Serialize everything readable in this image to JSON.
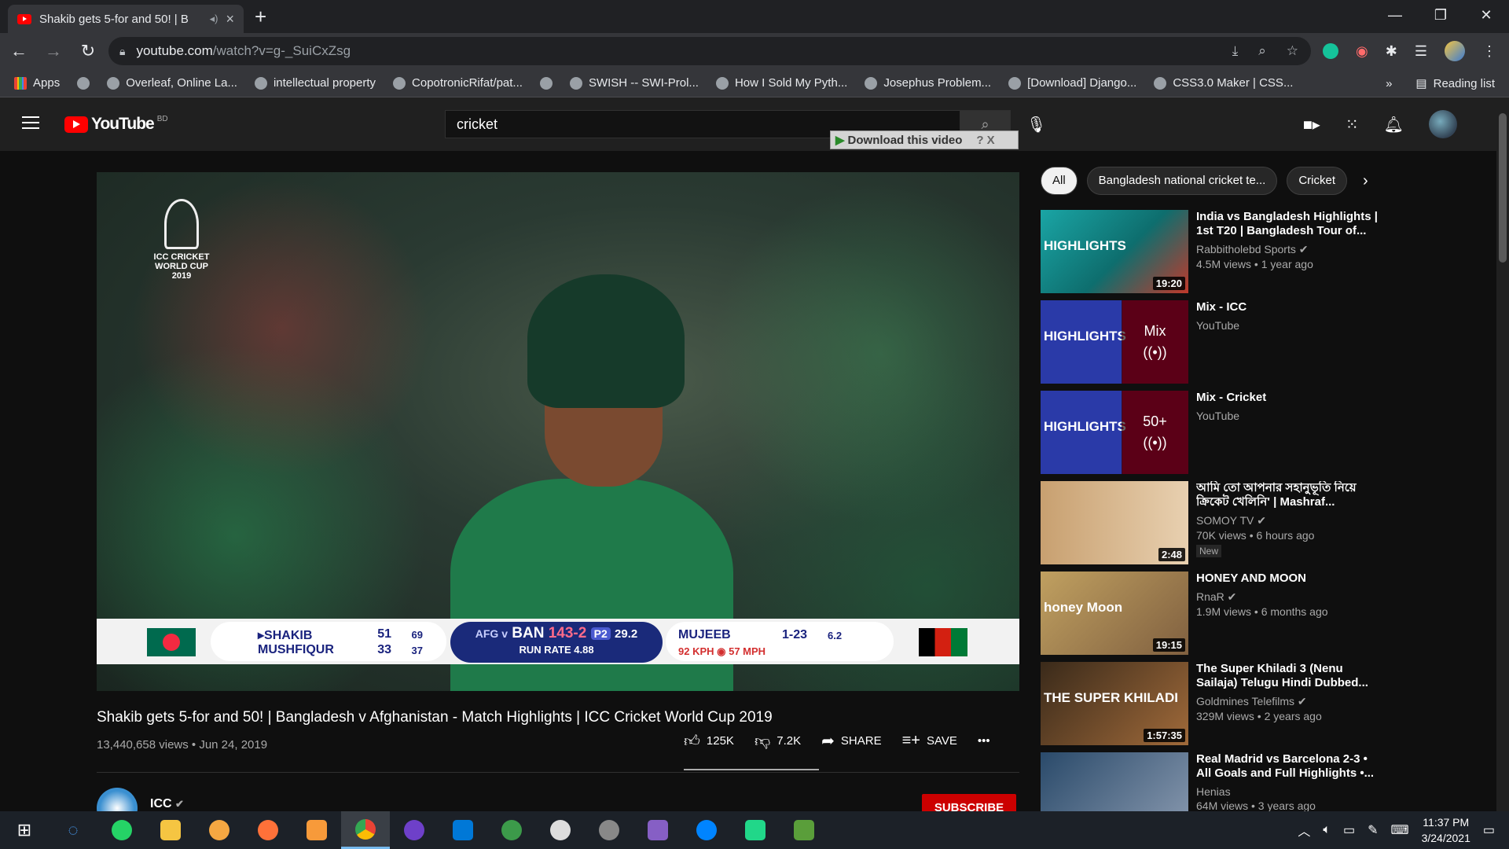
{
  "browser": {
    "tab_title": "Shakib gets 5-for and 50! | B",
    "url_host": "youtube.com",
    "url_path": "/watch?v=g-_SuiCxZsg",
    "window_controls": [
      "—",
      "❐",
      "✕"
    ]
  },
  "bookmarks": [
    {
      "label": "Apps",
      "icon": "apps-grid-icon"
    },
    {
      "label": "",
      "icon": "globe-icon"
    },
    {
      "label": "Overleaf, Online La...",
      "icon": "overleaf-icon"
    },
    {
      "label": "intellectual property",
      "icon": "bookmark-s-icon"
    },
    {
      "label": "CopotronicRifat/pat...",
      "icon": "github-icon"
    },
    {
      "label": "",
      "icon": "globe-icon"
    },
    {
      "label": "SWISH -- SWI-Prol...",
      "icon": "swish-icon"
    },
    {
      "label": "How I Sold My Pyth...",
      "icon": "youtube-icon"
    },
    {
      "label": "Josephus Problem...",
      "icon": "loading-icon"
    },
    {
      "label": "[Download] Django...",
      "icon": "django-icon"
    },
    {
      "label": "CSS3.0 Maker | CSS...",
      "icon": "globe-icon"
    }
  ],
  "bookmarks_more": "»",
  "reading_list": "Reading list",
  "youtube": {
    "logo_text": "YouTube",
    "country": "BD",
    "search_value": "cricket",
    "download_bar": "Download this video",
    "download_help": "?",
    "download_close": "X"
  },
  "video": {
    "title": "Shakib gets 5-for and 50! | Bangladesh v Afghanistan - Match Highlights | ICC Cricket World Cup 2019",
    "meta": "13,440,658 views • Jun 24, 2019",
    "likes": "125K",
    "dislikes": "7.2K",
    "share": "SHARE",
    "save": "SAVE",
    "more": "•••",
    "overlay_logo": "ICC CRICKET WORLD CUP 2019",
    "channel": "ICC",
    "subscribe": "SUBSCRIBE"
  },
  "scoreboard": {
    "batsmen": [
      {
        "name": "▸SHAKIB",
        "runs": "51",
        "balls": "69"
      },
      {
        "name": "MUSHFIQUR",
        "runs": "33",
        "balls": "37"
      }
    ],
    "afg_v": "AFG v",
    "team": "BAN",
    "score": "143-2",
    "powerplay": "P2",
    "overs": "29.2",
    "run_rate": "RUN RATE 4.88",
    "bowler": "MUJEEB",
    "bowler_figures": "1-23",
    "bowler_overs": "6.2",
    "speed": "92 KPH  ◉  57 MPH"
  },
  "chips": [
    "All",
    "Bangladesh national cricket te...",
    "Cricket"
  ],
  "recommendations": [
    {
      "title": "India vs Bangladesh Highlights | 1st T20 | Bangladesh Tour of...",
      "channel": "Rabbitholebd Sports ✔",
      "views": "4.5M views • 1 year ago",
      "duration": "19:20",
      "thumb_text": "HIGHLIGHTS",
      "badge": "",
      "mix": ""
    },
    {
      "title": "Mix - ICC",
      "channel": "YouTube",
      "views": "",
      "duration": "",
      "thumb_text": "HIGHLIGHTS",
      "badge": "",
      "mix": "Mix"
    },
    {
      "title": "Mix - Cricket",
      "channel": "YouTube",
      "views": "",
      "duration": "",
      "thumb_text": "HIGHLIGHTS",
      "badge": "",
      "mix": "50+"
    },
    {
      "title": "আমি তো আপনার সহানুভূতি নিয়ে ক্রিকেট খেলিনি' | Mashraf...",
      "channel": "SOMOY TV ✔",
      "views": "70K views • 6 hours ago",
      "duration": "2:48",
      "thumb_text": "",
      "badge": "New",
      "mix": ""
    },
    {
      "title": "HONEY AND MOON",
      "channel": "RnaR ✔",
      "views": "1.9M views • 6 months ago",
      "duration": "19:15",
      "thumb_text": "honey Moon",
      "badge": "",
      "mix": ""
    },
    {
      "title": "The Super Khiladi 3 (Nenu Sailaja) Telugu Hindi Dubbed...",
      "channel": "Goldmines Telefilms ✔",
      "views": "329M views • 2 years ago",
      "duration": "1:57:35",
      "thumb_text": "THE SUPER KHILADI",
      "badge": "",
      "mix": ""
    },
    {
      "title": "Real Madrid vs Barcelona 2-3 • All Goals and Full Highlights •...",
      "channel": "Henias",
      "views": "64M views • 3 years ago",
      "duration": "",
      "thumb_text": "",
      "badge": "",
      "mix": ""
    }
  ],
  "taskbar": {
    "time": "11:37 PM",
    "date": "3/24/2021"
  },
  "colors": {
    "youtube_red": "#ff0000",
    "subscribe": "#cc0000",
    "scoreboard_blue": "#1a2a7a"
  }
}
